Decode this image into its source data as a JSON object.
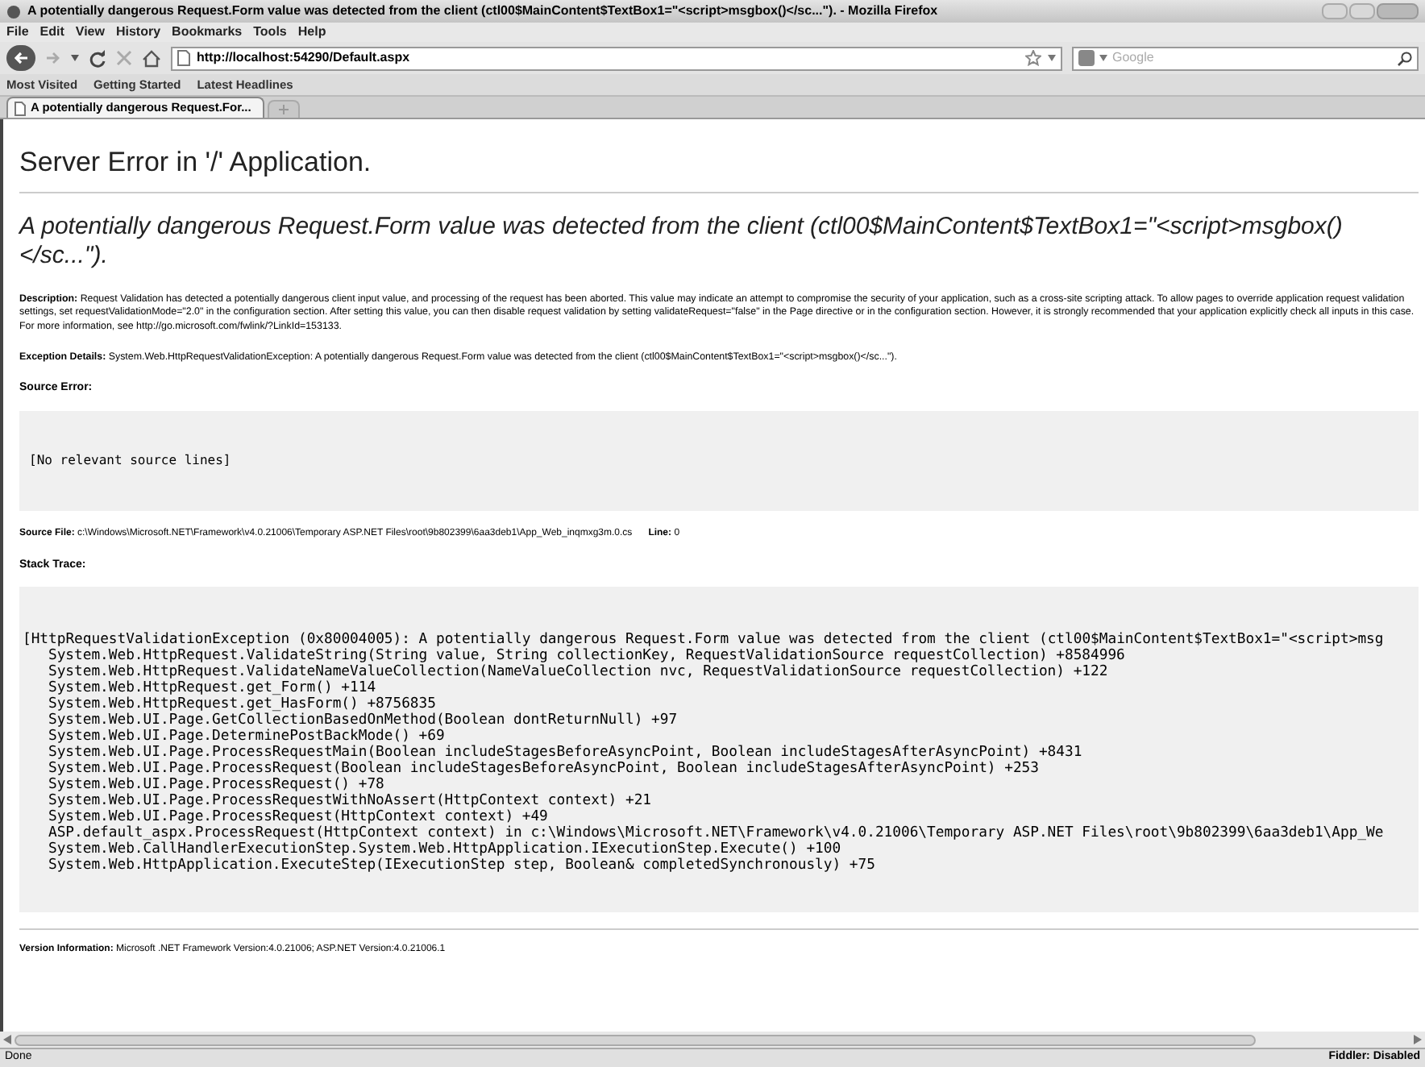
{
  "window": {
    "title": "A potentially dangerous Request.Form value was detected from the client (ctl00$MainContent$TextBox1=\"<script>msgbox()</sc...\"). - Mozilla Firefox"
  },
  "menu": [
    {
      "label": "File"
    },
    {
      "label": "Edit"
    },
    {
      "label": "View"
    },
    {
      "label": "History"
    },
    {
      "label": "Bookmarks"
    },
    {
      "label": "Tools"
    },
    {
      "label": "Help"
    }
  ],
  "nav": {
    "url": "http://localhost:54290/Default.aspx",
    "search_placeholder": "Google"
  },
  "bookmarks": [
    {
      "label": "Most Visited"
    },
    {
      "label": "Getting Started"
    },
    {
      "label": "Latest Headlines"
    }
  ],
  "tabs": [
    {
      "label": "A potentially dangerous Request.For...",
      "selected": true
    }
  ],
  "page": {
    "heading": "Server Error in '/' Application.",
    "error_title": "A potentially dangerous Request.Form value was detected from the client (ctl00$MainContent$TextBox1=\"<script>msgbox()</sc...\").",
    "description": "**Description:** Request Validation has detected a potentially dangerous client input value, and processing of the request has been aborted. This value may indicate an attempt to compromise the security of your application, such as a cross-site scripting attack. To allow pages to override application request validation settings, set requestValidationMode=\"2.0\" in the configuration section. After setting this value, you can then disable request validation by setting validateRequest=\"false\" in the Page directive or in the configuration section. However, it is strongly recommended that your application explicitly check all inputs in this case. For more information, see http://go.microsoft.com/fwlink/?LinkId=153133.",
    "exception": "**Exception Details:** System.Web.HttpRequestValidationException: A potentially dangerous Request.Form value was detected from the client (ctl00$MainContent$TextBox1=\"<script>msgbox()</sc...\").",
    "source_error_label": "Source Error:",
    "source_error": "[No relevant source lines]",
    "source_file": "**Source File:** c:\\Windows\\Microsoft.NET\\Framework\\v4.0.21006\\Temporary ASP.NET Files\\root\\9b802399\\6aa3deb1\\App_Web_inqmxg3m.0.cs",
    "line": "**Line:** 0",
    "stack_trace_label": "Stack Trace:",
    "stack_trace": {
      "exception": "[HttpRequestValidationException (0x80004005): A potentially dangerous Request.Form value was detected from the client (ctl00$MainContent$TextBox1=\"<script>msg",
      "frames": [
        "System.Web.HttpRequest.ValidateString(String value, String collectionKey, RequestValidationSource requestCollection) +8584996",
        "System.Web.HttpRequest.ValidateNameValueCollection(NameValueCollection nvc, RequestValidationSource requestCollection) +122",
        "System.Web.HttpRequest.get_Form() +114",
        "System.Web.HttpRequest.get_HasForm() +8756835",
        "System.Web.UI.Page.GetCollectionBasedOnMethod(Boolean dontReturnNull) +97",
        "System.Web.UI.Page.DeterminePostBackMode() +69",
        "System.Web.UI.Page.ProcessRequestMain(Boolean includeStagesBeforeAsyncPoint, Boolean includeStagesAfterAsyncPoint) +8431",
        "System.Web.UI.Page.ProcessRequest(Boolean includeStagesBeforeAsyncPoint, Boolean includeStagesAfterAsyncPoint) +253",
        "System.Web.UI.Page.ProcessRequest() +78",
        "System.Web.UI.Page.ProcessRequestWithNoAssert(HttpContext context) +21",
        "System.Web.UI.Page.ProcessRequest(HttpContext context) +49",
        "ASP.default_aspx.ProcessRequest(HttpContext context) in c:\\Windows\\Microsoft.NET\\Framework\\v4.0.21006\\Temporary ASP.NET Files\\root\\9b802399\\6aa3deb1\\App_We",
        "System.Web.CallHandlerExecutionStep.System.Web.HttpApplication.IExecutionStep.Execute() +100",
        "System.Web.HttpApplication.ExecuteStep(IExecutionStep step, Boolean& completedSynchronously) +75"
      ]
    },
    "version": "**Version Information:** Microsoft .NET Framework Version:4.0.21006; ASP.NET Version:4.0.21006.1"
  },
  "status_bar": {
    "left": "Done",
    "right": "Fiddler: Disabled"
  }
}
